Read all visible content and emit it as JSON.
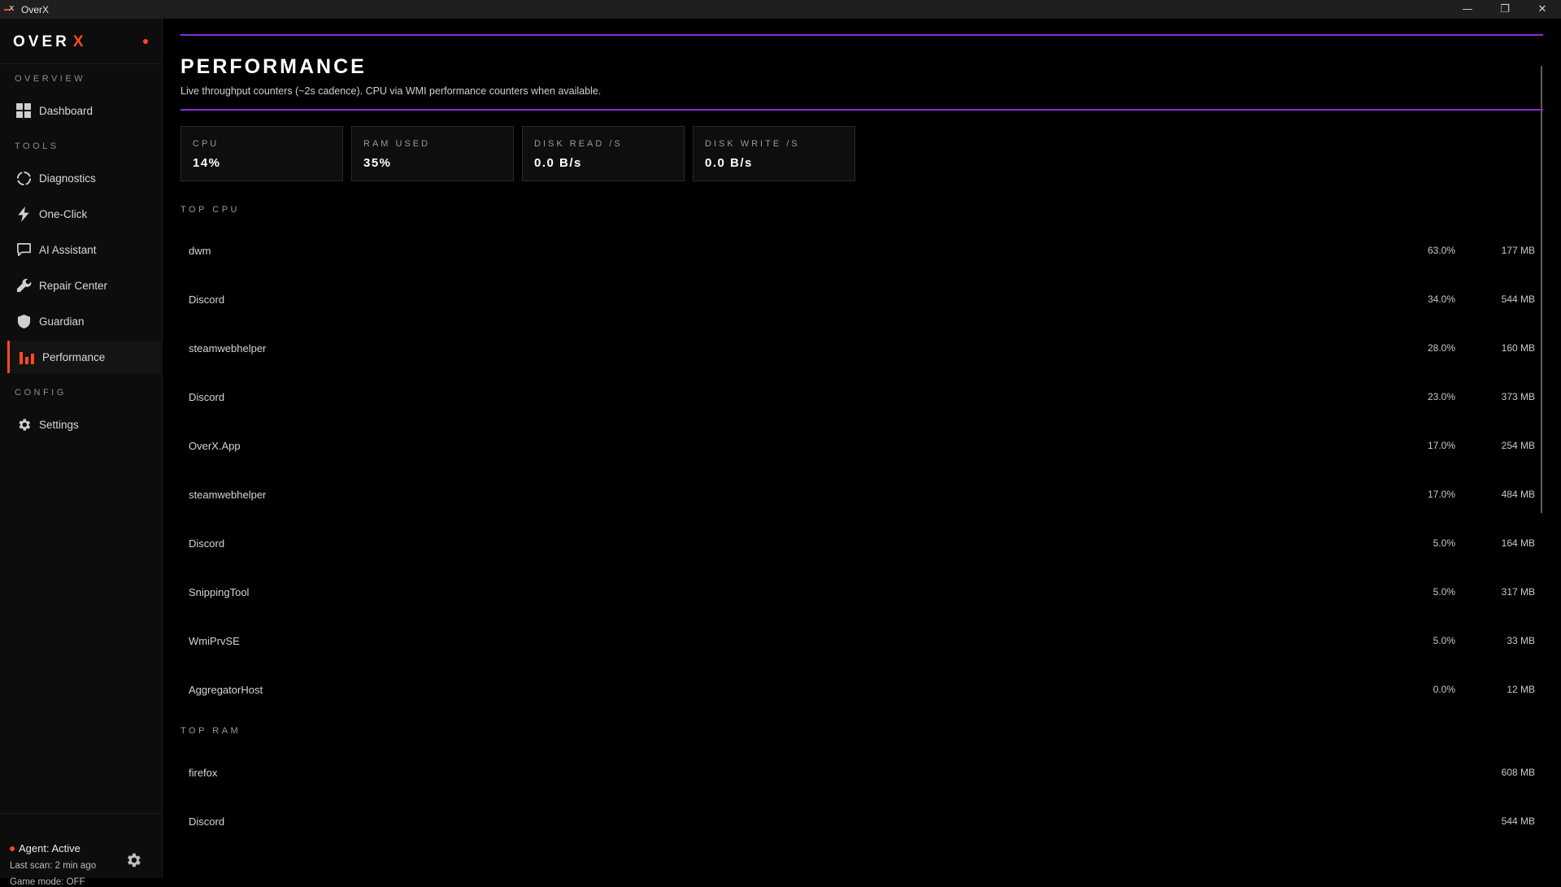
{
  "window": {
    "title": "OverX",
    "minimize": "—",
    "restore": "❐",
    "close": "✕"
  },
  "sidebar": {
    "brand_main": "OVER",
    "brand_x": "X",
    "sections": {
      "overview": "OVERVIEW",
      "tools": "TOOLS",
      "config": "CONFIG"
    },
    "items": [
      {
        "label": "Dashboard",
        "icon": "grid-icon"
      },
      {
        "label": "Diagnostics",
        "icon": "circle-icon"
      },
      {
        "label": "One-Click",
        "icon": "bolt-icon"
      },
      {
        "label": "AI Assistant",
        "icon": "chat-icon"
      },
      {
        "label": "Repair Center",
        "icon": "wrench-icon"
      },
      {
        "label": "Guardian",
        "icon": "shield-icon"
      },
      {
        "label": "Performance",
        "icon": "bar-chart-icon",
        "active": true
      },
      {
        "label": "Settings",
        "icon": "gear-icon"
      }
    ],
    "footer": {
      "agent": "Agent: Active",
      "last_scan": "Last scan: 2 min ago",
      "game_mode": "Game mode: OFF"
    }
  },
  "main": {
    "title": "PERFORMANCE",
    "subtitle": "Live throughput counters (~2s cadence). CPU via WMI performance counters when available.",
    "stats": [
      {
        "label": "CPU",
        "value": "14%"
      },
      {
        "label": "RAM USED",
        "value": "35%"
      },
      {
        "label": "DISK READ /S",
        "value": "0.0 B/s"
      },
      {
        "label": "DISK WRITE /S",
        "value": "0.0 B/s"
      }
    ],
    "top_cpu_label": "TOP CPU",
    "top_cpu": [
      {
        "name": "dwm",
        "cpu": "63.0%",
        "mem": "177 MB"
      },
      {
        "name": "Discord",
        "cpu": "34.0%",
        "mem": "544 MB"
      },
      {
        "name": "steamwebhelper",
        "cpu": "28.0%",
        "mem": "160 MB"
      },
      {
        "name": "Discord",
        "cpu": "23.0%",
        "mem": "373 MB"
      },
      {
        "name": "OverX.App",
        "cpu": "17.0%",
        "mem": "254 MB"
      },
      {
        "name": "steamwebhelper",
        "cpu": "17.0%",
        "mem": "484 MB"
      },
      {
        "name": "Discord",
        "cpu": "5.0%",
        "mem": "164 MB"
      },
      {
        "name": "SnippingTool",
        "cpu": "5.0%",
        "mem": "317 MB"
      },
      {
        "name": "WmiPrvSE",
        "cpu": "5.0%",
        "mem": "33 MB"
      },
      {
        "name": "AggregatorHost",
        "cpu": "0.0%",
        "mem": "12 MB"
      }
    ],
    "top_ram_label": "TOP RAM",
    "top_ram": [
      {
        "name": "firefox",
        "mem": "608 MB"
      },
      {
        "name": "Discord",
        "mem": "544 MB"
      }
    ]
  },
  "colors": {
    "accent": "#ff4b1f",
    "purple": "#8a2be2",
    "background": "#000000",
    "sidebar": "#0d0d0d"
  }
}
